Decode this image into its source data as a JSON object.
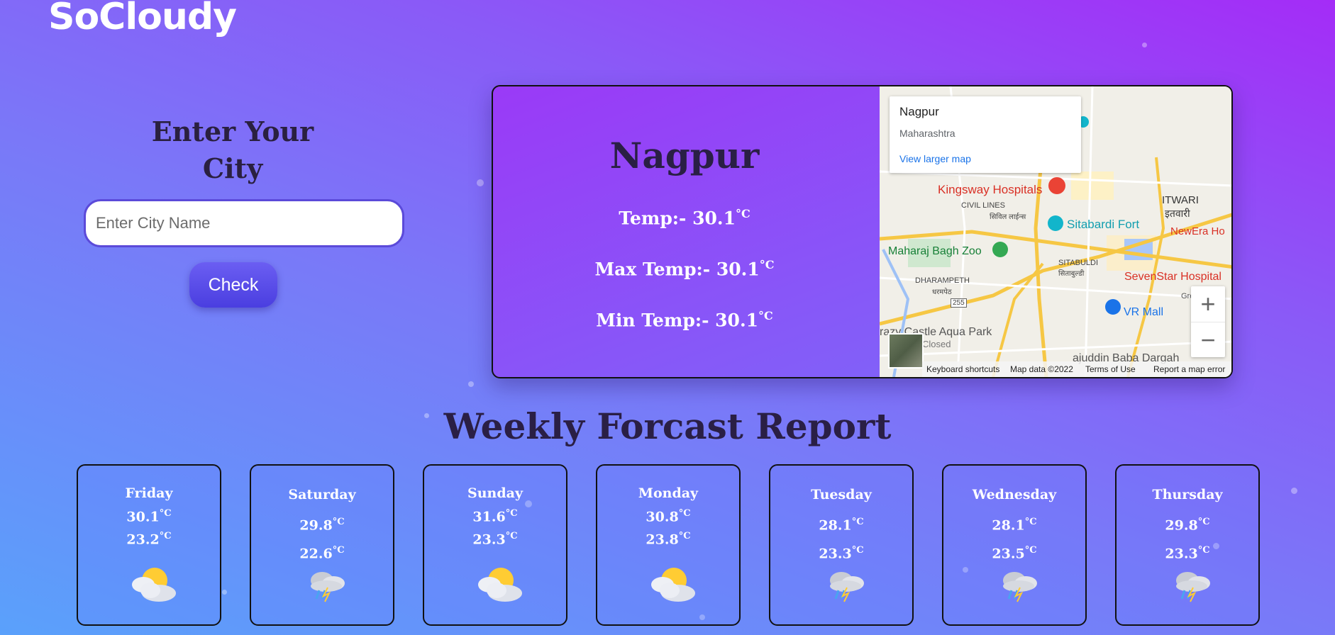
{
  "app": {
    "logo": "SoCloudy"
  },
  "search": {
    "heading_line1": "Enter Your",
    "heading_line2": "City",
    "placeholder": "Enter City Name",
    "value": "",
    "button_label": "Check"
  },
  "current": {
    "city": "Nagpur",
    "temp_label": "Temp:- 30.1",
    "max_label": "Max Temp:- 30.1",
    "min_label": "Min Temp:- 30.1",
    "unit": "°C"
  },
  "map": {
    "popup_title": "Nagpur",
    "popup_subtitle": "Maharashtra",
    "popup_link": "View larger map",
    "labels": {
      "kingsway": "Kingsway Hospitals",
      "civil_lines": "CIVIL LINES",
      "civil_lines_local": "सिविल लाईन्स",
      "itwari": "ITWARI",
      "itwari_local": "इतवारी",
      "sitabardi_fort": "Sitabardi Fort",
      "newera": "NewEra Ho",
      "maharaj_bagh": "Maharaj Bagh Zoo",
      "sitabuldi": "SITABULDI",
      "sitabuldi_local": "सिताबुल्डी",
      "sevenstar": "SevenStar Hospital",
      "dharampeth": "DHARAMPETH",
      "dharampeth_local": "धरमपेठ",
      "route": "255",
      "vr_mall": "VR Mall",
      "great_n": "Great N",
      "aqua_park": "razy Castle Aqua Park",
      "closed": "Closed",
      "dargah": "ajuddin Baba Dargah"
    },
    "zoom_in": "+",
    "zoom_out": "−",
    "footer": {
      "shortcuts": "Keyboard shortcuts",
      "data": "Map data ©2022",
      "terms": "Terms of Use",
      "report": "Report a map error"
    }
  },
  "weekly": {
    "title": "Weekly Forcast Report",
    "unit": "°C",
    "days": [
      {
        "name": "Friday",
        "max": "30.1",
        "min": "23.2",
        "icon": "sun-behind-cloud-icon"
      },
      {
        "name": "Saturday",
        "max": "29.8",
        "min": "22.6",
        "icon": "cloud-rain-icon"
      },
      {
        "name": "Sunday",
        "max": "31.6",
        "min": "23.3",
        "icon": "sun-behind-cloud-icon"
      },
      {
        "name": "Monday",
        "max": "30.8",
        "min": "23.8",
        "icon": "sun-behind-cloud-icon"
      },
      {
        "name": "Tuesday",
        "max": "28.1",
        "min": "23.3",
        "icon": "cloud-rain-icon"
      },
      {
        "name": "Wednesday",
        "max": "28.1",
        "min": "23.5",
        "icon": "cloud-rain-icon"
      },
      {
        "name": "Thursday",
        "max": "29.8",
        "min": "23.3",
        "icon": "cloud-rain-icon"
      }
    ]
  },
  "colors": {
    "bg_top": "#a42cf7",
    "bg_bottom": "#5aa1fb",
    "heading_dark": "#2a1f45",
    "button": "#5b4ad9"
  }
}
